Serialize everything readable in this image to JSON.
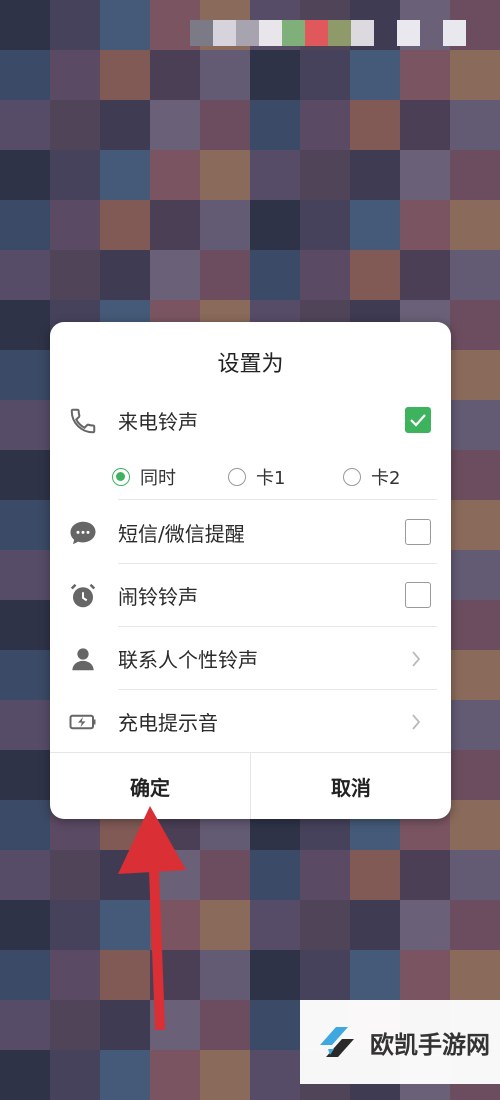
{
  "dialog": {
    "title": "设置为",
    "rows": [
      {
        "label": "来电铃声",
        "icon": "phone-icon",
        "checked": true
      },
      {
        "label": "短信/微信提醒",
        "icon": "message-icon",
        "checked": false
      },
      {
        "label": "闹铃铃声",
        "icon": "alarm-clock-icon",
        "checked": false
      },
      {
        "label": "联系人个性铃声",
        "icon": "contact-icon"
      },
      {
        "label": "充电提示音",
        "icon": "charging-battery-icon"
      }
    ],
    "sim_options": [
      {
        "label": "同时",
        "selected": true
      },
      {
        "label": "卡1",
        "selected": false
      },
      {
        "label": "卡2",
        "selected": false
      }
    ],
    "confirm_label": "确定",
    "cancel_label": "取消"
  },
  "watermark": {
    "text": "欧凯手游网"
  },
  "colors": {
    "accent": "#3db35e",
    "arrow": "#d92f35"
  }
}
